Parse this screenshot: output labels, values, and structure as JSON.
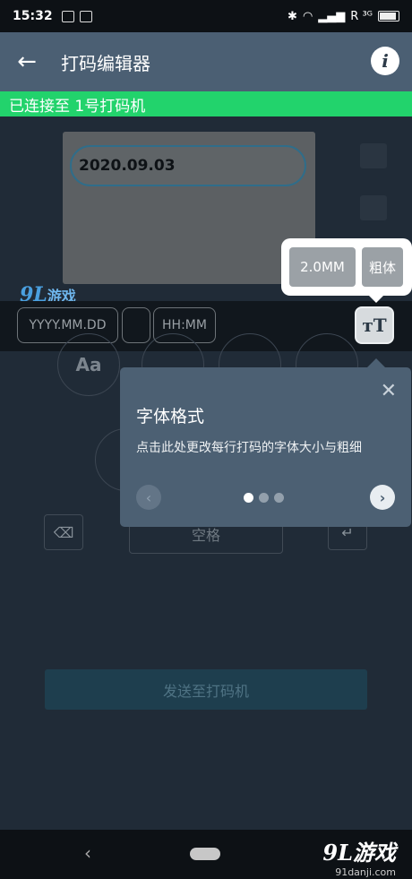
{
  "status_bar": {
    "time": "15:32",
    "network": "R ³ᴳ"
  },
  "app_bar": {
    "back_glyph": "←",
    "title": "打码编辑器",
    "info_glyph": "i"
  },
  "connection_banner": "已连接至 1号打码机",
  "editor": {
    "line_text": "2020.09.03"
  },
  "chips": {
    "date": "YYYY.MM.DD",
    "time": "HH:MM"
  },
  "font_button_glyph": "ᴛT",
  "font_options": {
    "size": "2.0MM",
    "bold": "粗体"
  },
  "watermark_top": {
    "logo": "9L",
    "text": "游戏"
  },
  "keypad": {
    "aa": "Aa",
    "space": "空格",
    "delete_glyph": "⌫",
    "enter_glyph": "↵"
  },
  "send_button": "发送至打码机",
  "tip": {
    "title": "字体格式",
    "description": "点击此处更改每行打码的字体大小与粗细",
    "close_glyph": "✕",
    "prev_glyph": "‹",
    "next_glyph": "›"
  },
  "nav_bar": {
    "back_glyph": "‹",
    "watermark_logo": "9L游戏",
    "watermark_url": "91danji.com"
  }
}
